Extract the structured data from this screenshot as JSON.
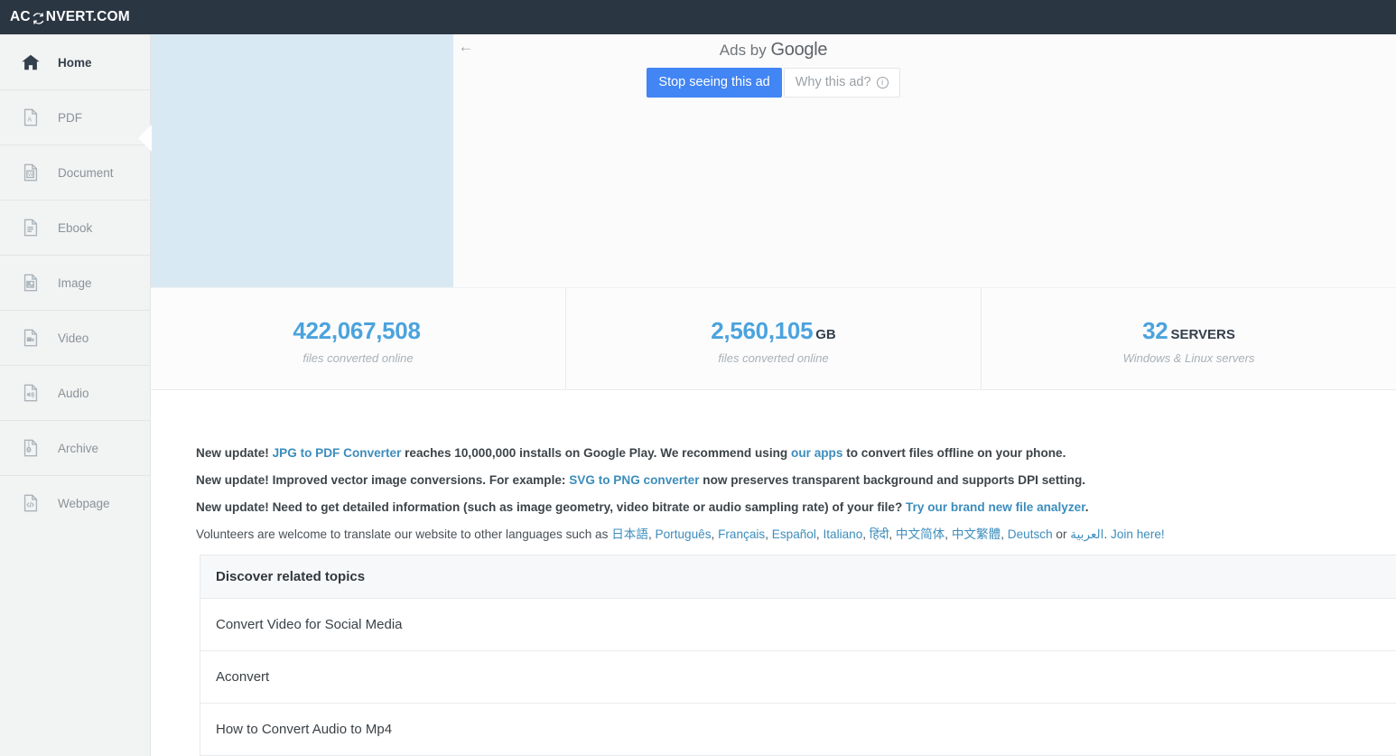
{
  "header": {
    "logo_prefix": "AC",
    "logo_icon": "refresh-cycle-icon",
    "logo_suffix": "NVERT.COM"
  },
  "sidebar": {
    "items": [
      {
        "label": "Home",
        "icon": "home-icon",
        "active": true
      },
      {
        "label": "PDF",
        "icon": "pdf-file-icon",
        "active": false
      },
      {
        "label": "Document",
        "icon": "word-file-icon",
        "active": false
      },
      {
        "label": "Ebook",
        "icon": "ebook-file-icon",
        "active": false
      },
      {
        "label": "Image",
        "icon": "image-file-icon",
        "active": false
      },
      {
        "label": "Video",
        "icon": "video-file-icon",
        "active": false
      },
      {
        "label": "Audio",
        "icon": "audio-file-icon",
        "active": false
      },
      {
        "label": "Archive",
        "icon": "archive-file-icon",
        "active": false
      },
      {
        "label": "Webpage",
        "icon": "code-file-icon",
        "active": false
      }
    ],
    "collapse_handle_icon": "chevron-left-icon"
  },
  "ad": {
    "back_arrow": "←",
    "ads_by_label": "Ads by",
    "ads_by_brand": "Google",
    "stop_button": "Stop seeing this ad",
    "why_button": "Why this ad?",
    "why_info_icon": "info-circle-icon",
    "banner_color": "#d9e9f3",
    "button_color": "#4285f4"
  },
  "stats": [
    {
      "value": "422,067,508",
      "unit": "",
      "caption": "files converted online"
    },
    {
      "value": "2,560,105",
      "unit": "GB",
      "caption": "files converted online"
    },
    {
      "value": "32",
      "unit": "SERVERS",
      "caption": "Windows & Linux servers"
    }
  ],
  "news": {
    "line1": {
      "a": "New update! ",
      "link1": "JPG to PDF Converter",
      "b": " reaches 10,000,000 installs on Google Play. We recommend using ",
      "link2": "our apps",
      "c": " to convert files offline on your phone."
    },
    "line2": {
      "a": "New update! Improved vector image conversions. For example: ",
      "link1": "SVG to PNG converter",
      "b": " now preserves transparent background and supports DPI setting."
    },
    "line3": {
      "a": "New update! Need to get detailed information (such as image geometry, video bitrate or audio sampling rate) of your file? ",
      "link1": "Try our brand new file analyzer",
      "b": "."
    },
    "line4": {
      "a": "Volunteers are welcome to translate our website to other languages such as ",
      "languages": [
        "日本語",
        "Português",
        "Français",
        "Español",
        "Italiano",
        "हिंदी",
        "中文简体",
        "中文繁體",
        "Deutsch"
      ],
      "or_word": " or ",
      "last_language": "العربية",
      "b": ". ",
      "join": "Join here!"
    }
  },
  "topics": {
    "heading": "Discover related topics",
    "rows": [
      "Convert Video for Social Media",
      "Aconvert",
      "How to Convert Audio to Mp4"
    ]
  },
  "colors": {
    "header_bg": "#2b3643",
    "sidebar_bg": "#f2f3f3",
    "accent_blue": "#4ba3dd",
    "link_blue": "#3c8dbc"
  }
}
